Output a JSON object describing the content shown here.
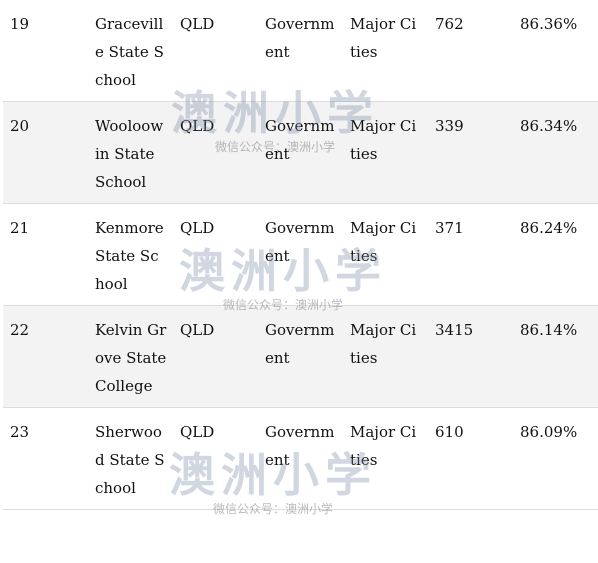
{
  "table": {
    "rows": [
      {
        "rank": "19",
        "name": "Graceville State School",
        "state": "QLD",
        "sector": "Government",
        "region": "Major Cities",
        "enrolment": "762",
        "score": "86.36%"
      },
      {
        "rank": "20",
        "name": "Wooloowin State School",
        "state": "QLD",
        "sector": "Government",
        "region": "Major Cities",
        "enrolment": "339",
        "score": "86.34%"
      },
      {
        "rank": "21",
        "name": "Kenmore State School",
        "state": "QLD",
        "sector": "Government",
        "region": "Major Cities",
        "enrolment": "371",
        "score": "86.24%"
      },
      {
        "rank": "22",
        "name": "Kelvin Grove State College",
        "state": "QLD",
        "sector": "Government",
        "region": "Major Cities",
        "enrolment": "3415",
        "score": "86.14%"
      },
      {
        "rank": "23",
        "name": "Sherwood State School",
        "state": "QLD",
        "sector": "Government",
        "region": "Major Cities",
        "enrolment": "610",
        "score": "86.09%"
      }
    ]
  },
  "watermark": {
    "logo": "澳洲小学",
    "caption": "微信公众号：澳洲小学"
  }
}
